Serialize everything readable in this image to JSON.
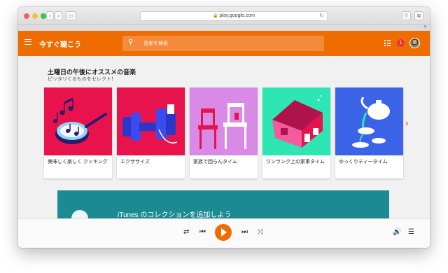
{
  "browser": {
    "url": "play.google.com",
    "back_label": "‹",
    "forward_label": "›",
    "more_label": "»"
  },
  "app": {
    "title": "今すぐ聴こう",
    "search_placeholder": "音楽を検索",
    "notification_count": "1",
    "accent_color": "#ef6c00"
  },
  "section": {
    "title": "土曜日の午後にオススメの音楽",
    "subtitle": "ピッタリくるものをセレクト！"
  },
  "cards": [
    {
      "label": "美味しく楽しく クッキング",
      "bg": "#e8134c"
    },
    {
      "label": "エクササイズ",
      "bg": "#e8134c"
    },
    {
      "label": "家族で団らんタイム",
      "bg": "#d98ae6"
    },
    {
      "label": "ワンランク上の家事タイム",
      "bg": "#2ee6b4"
    },
    {
      "label": "ゆっくりティータイム",
      "bg": "#3a63e8"
    }
  ],
  "banner": {
    "text": "iTunes のコレクションを追加しよう"
  }
}
